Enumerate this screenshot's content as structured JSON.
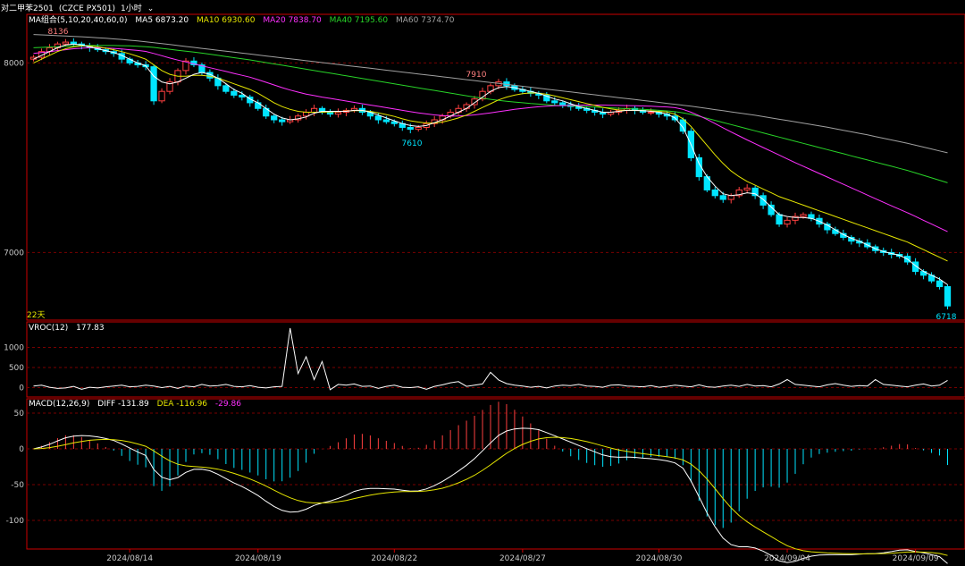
{
  "header": {
    "symbol": "对二甲苯2501",
    "code": "(CZCE PX501)",
    "interval": "1小时"
  },
  "legend_main": {
    "group": "MA组合(5,10,20,40,60,0)",
    "ma5": "MA5 6873.20",
    "ma10": "MA10 6930.60",
    "ma20": "MA20 7838.70",
    "ma40": "MA40 7195.60",
    "ma60": "MA60 7374.70"
  },
  "legend_vroc": {
    "name": "VROC(12)",
    "value": "177.83"
  },
  "legend_macd": {
    "name": "MACD(12,26,9)",
    "diff": "DIFF -131.89",
    "dea": "DEA -116.96",
    "macd": "-29.86"
  },
  "colors": {
    "up": "#ff4040",
    "down": "#00e5ff",
    "ma5": "#ffffff",
    "ma10": "#e6e600",
    "ma20": "#ff30ff",
    "ma40": "#28d428",
    "ma60": "#a0a0a0",
    "grid": "#7a0000",
    "axis": "#cc0000"
  },
  "chart_data": {
    "type": "candlestick",
    "price_axis": {
      "ticks": [
        "8000",
        "7000"
      ],
      "ylim": [
        6700,
        8200
      ]
    },
    "vroc_axis": {
      "ticks": [
        "1000",
        "500",
        "0"
      ],
      "ylim": [
        -100,
        1500
      ]
    },
    "macd_axis": {
      "ticks": [
        "50",
        "0",
        "-50",
        "-100"
      ],
      "ylim": [
        -130,
        60
      ]
    },
    "dates": [
      "2024/08/14",
      "2024/08/19",
      "2024/08/22",
      "2024/08/27",
      "2024/08/30",
      "2024/09/04",
      "2024/09/09"
    ],
    "annotations": {
      "high1": "8136",
      "high2": "7910",
      "low1": "7610",
      "last": "6718",
      "bars": "22天"
    },
    "close": [
      8030,
      8060,
      8080,
      8100,
      8110,
      8100,
      8090,
      8080,
      8070,
      8060,
      8050,
      8020,
      8000,
      7990,
      7980,
      7800,
      7850,
      7900,
      7960,
      8010,
      7990,
      7950,
      7920,
      7880,
      7850,
      7830,
      7820,
      7790,
      7760,
      7720,
      7700,
      7690,
      7700,
      7720,
      7740,
      7760,
      7740,
      7730,
      7740,
      7750,
      7760,
      7740,
      7720,
      7700,
      7690,
      7680,
      7660,
      7650,
      7660,
      7680,
      7700,
      7720,
      7740,
      7760,
      7780,
      7810,
      7850,
      7880,
      7900,
      7880,
      7860,
      7850,
      7840,
      7830,
      7800,
      7790,
      7780,
      7770,
      7760,
      7750,
      7740,
      7730,
      7740,
      7750,
      7760,
      7750,
      7740,
      7740,
      7730,
      7720,
      7700,
      7640,
      7500,
      7400,
      7330,
      7300,
      7280,
      7300,
      7330,
      7340,
      7300,
      7250,
      7200,
      7150,
      7170,
      7190,
      7200,
      7180,
      7150,
      7120,
      7100,
      7080,
      7060,
      7050,
      7030,
      7010,
      7000,
      6990,
      6980,
      6950,
      6900,
      6880,
      6850,
      6820,
      6718
    ],
    "ma5": [
      8020,
      8040,
      8060,
      8080,
      8095,
      8100,
      8095,
      8085,
      8075,
      8065,
      8055,
      8040,
      8020,
      8000,
      7985,
      7930,
      7900,
      7890,
      7900,
      7920,
      7940,
      7950,
      7940,
      7920,
      7890,
      7860,
      7840,
      7810,
      7790,
      7760,
      7730,
      7710,
      7700,
      7705,
      7715,
      7735,
      7745,
      7745,
      7745,
      7745,
      7750,
      7750,
      7740,
      7725,
      7710,
      7695,
      7680,
      7670,
      7665,
      7670,
      7685,
      7700,
      7720,
      7740,
      7760,
      7790,
      7820,
      7850,
      7870,
      7875,
      7870,
      7860,
      7850,
      7840,
      7825,
      7810,
      7800,
      7785,
      7770,
      7760,
      7750,
      7740,
      7740,
      7745,
      7750,
      7750,
      7748,
      7745,
      7740,
      7730,
      7710,
      7660,
      7570,
      7470,
      7400,
      7350,
      7310,
      7300,
      7305,
      7315,
      7310,
      7280,
      7240,
      7200,
      7190,
      7185,
      7185,
      7180,
      7165,
      7145,
      7120,
      7095,
      7075,
      7060,
      7040,
      7020,
      7005,
      6995,
      6985,
      6965,
      6930,
      6900,
      6880,
      6860,
      6830
    ],
    "ma10": [
      8000,
      8020,
      8040,
      8060,
      8075,
      8085,
      8090,
      8090,
      8085,
      8078,
      8070,
      8060,
      8048,
      8035,
      8020,
      7990,
      7960,
      7940,
      7930,
      7930,
      7935,
      7935,
      7930,
      7920,
      7905,
      7890,
      7875,
      7860,
      7840,
      7815,
      7790,
      7770,
      7755,
      7745,
      7740,
      7740,
      7740,
      7742,
      7744,
      7746,
      7748,
      7748,
      7745,
      7737,
      7728,
      7718,
      7705,
      7695,
      7688,
      7683,
      7683,
      7688,
      7698,
      7710,
      7725,
      7745,
      7765,
      7785,
      7805,
      7820,
      7830,
      7838,
      7842,
      7840,
      7835,
      7826,
      7816,
      7806,
      7796,
      7786,
      7776,
      7766,
      7758,
      7752,
      7750,
      7749,
      7748,
      7747,
      7745,
      7741,
      7730,
      7705,
      7665,
      7615,
      7565,
      7515,
      7470,
      7430,
      7400,
      7375,
      7355,
      7335,
      7315,
      7295,
      7280,
      7265,
      7250,
      7235,
      7220,
      7205,
      7190,
      7175,
      7160,
      7145,
      7130,
      7115,
      7100,
      7085,
      7070,
      7055,
      7035,
      7015,
      6995,
      6975,
      6955
    ],
    "ma20": [
      8050,
      8055,
      8060,
      8065,
      8070,
      8075,
      8078,
      8080,
      8080,
      8079,
      8077,
      8074,
      8070,
      8066,
      8061,
      8050,
      8038,
      8026,
      8015,
      8005,
      7995,
      7985,
      7975,
      7965,
      7955,
      7945,
      7935,
      7925,
      7912,
      7898,
      7884,
      7870,
      7857,
      7846,
      7836,
      7828,
      7820,
      7813,
      7806,
      7799,
      7792,
      7785,
      7778,
      7771,
      7764,
      7757,
      7750,
      7743,
      7737,
      7731,
      7726,
      7722,
      7720,
      7720,
      7722,
      7726,
      7731,
      7737,
      7743,
      7749,
      7755,
      7760,
      7765,
      7769,
      7772,
      7774,
      7775,
      7776,
      7777,
      7778,
      7778,
      7778,
      7777,
      7776,
      7775,
      7774,
      7773,
      7772,
      7770,
      7768,
      7764,
      7755,
      7740,
      7722,
      7702,
      7680,
      7658,
      7636,
      7615,
      7594,
      7574,
      7554,
      7534,
      7514,
      7494,
      7474,
      7455,
      7436,
      7417,
      7398,
      7379,
      7360,
      7341,
      7322,
      7303,
      7284,
      7265,
      7246,
      7228,
      7210,
      7190,
      7170,
      7150,
      7130,
      7110
    ],
    "ma40": [
      8080,
      8082,
      8084,
      8086,
      8088,
      8090,
      8091,
      8092,
      8092,
      8092,
      8092,
      8091,
      8090,
      8088,
      8086,
      8082,
      8077,
      8072,
      8067,
      8062,
      8057,
      8052,
      8046,
      8040,
      8034,
      8028,
      8022,
      8016,
      8009,
      8002,
      7995,
      7988,
      7981,
      7974,
      7967,
      7960,
      7953,
      7946,
      7939,
      7932,
      7925,
      7918,
      7911,
      7904,
      7897,
      7890,
      7883,
      7876,
      7869,
      7862,
      7855,
      7848,
      7841,
      7834,
      7827,
      7820,
      7814,
      7808,
      7803,
      7798,
      7794,
      7790,
      7786,
      7783,
      7780,
      7777,
      7775,
      7773,
      7771,
      7769,
      7767,
      7765,
      7763,
      7761,
      7759,
      7757,
      7755,
      7753,
      7750,
      7747,
      7743,
      7737,
      7729,
      7719,
      7708,
      7697,
      7686,
      7675,
      7664,
      7653,
      7642,
      7631,
      7620,
      7609,
      7598,
      7587,
      7576,
      7565,
      7554,
      7543,
      7532,
      7521,
      7510,
      7499,
      7488,
      7477,
      7466,
      7455,
      7444,
      7433,
      7420,
      7407,
      7394,
      7381,
      7368
    ],
    "ma60": [
      8150,
      8148,
      8146,
      8144,
      8142,
      8140,
      8138,
      8136,
      8133,
      8130,
      8127,
      8124,
      8120,
      8116,
      8112,
      8107,
      8102,
      8097,
      8092,
      8087,
      8082,
      8077,
      8072,
      8067,
      8062,
      8057,
      8052,
      8047,
      8042,
      8037,
      8032,
      8027,
      8022,
      8017,
      8012,
      8007,
      8002,
      7997,
      7992,
      7987,
      7982,
      7977,
      7972,
      7967,
      7962,
      7957,
      7952,
      7947,
      7942,
      7937,
      7932,
      7927,
      7922,
      7917,
      7912,
      7907,
      7902,
      7897,
      7892,
      7887,
      7882,
      7877,
      7872,
      7867,
      7862,
      7857,
      7852,
      7847,
      7842,
      7837,
      7832,
      7827,
      7822,
      7817,
      7812,
      7807,
      7802,
      7797,
      7792,
      7787,
      7782,
      7777,
      7772,
      7766,
      7760,
      7754,
      7748,
      7742,
      7736,
      7730,
      7724,
      7717,
      7710,
      7703,
      7696,
      7689,
      7682,
      7675,
      7668,
      7661,
      7653,
      7645,
      7637,
      7629,
      7621,
      7612,
      7603,
      7594,
      7585,
      7576,
      7566,
      7556,
      7546,
      7536,
      7526
    ],
    "vroc": [
      40,
      60,
      10,
      -20,
      -10,
      30,
      -40,
      10,
      -10,
      20,
      40,
      60,
      20,
      30,
      60,
      40,
      0,
      30,
      -20,
      40,
      20,
      80,
      40,
      50,
      80,
      30,
      20,
      50,
      10,
      -10,
      20,
      30,
      1480,
      350,
      770,
      200,
      650,
      -50,
      80,
      60,
      90,
      30,
      40,
      -20,
      30,
      60,
      10,
      0,
      20,
      -40,
      30,
      70,
      120,
      150,
      30,
      60,
      90,
      380,
      190,
      100,
      60,
      40,
      10,
      30,
      -10,
      40,
      60,
      50,
      80,
      40,
      30,
      10,
      60,
      70,
      40,
      30,
      20,
      50,
      10,
      30,
      60,
      40,
      20,
      70,
      20,
      10,
      40,
      60,
      30,
      80,
      40,
      50,
      20,
      90,
      200,
      80,
      60,
      40,
      20,
      70,
      100,
      60,
      30,
      50,
      40,
      200,
      80,
      60,
      40,
      20,
      60,
      90,
      40,
      60,
      180
    ]
  }
}
